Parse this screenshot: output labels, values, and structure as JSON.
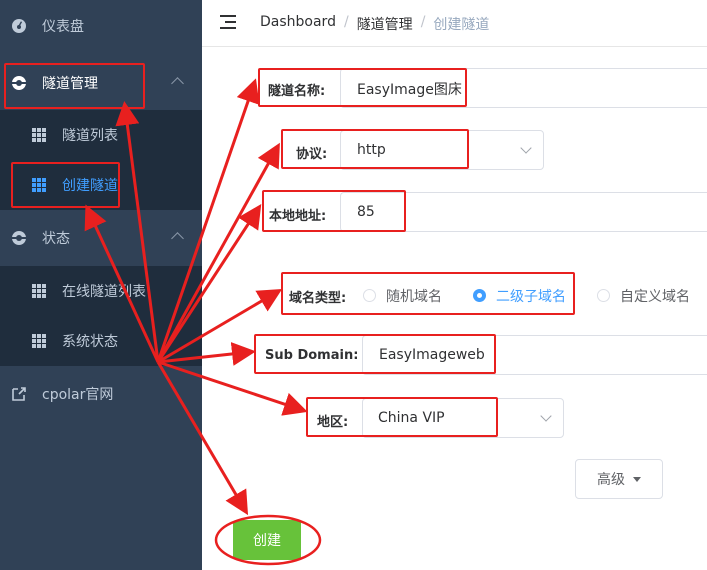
{
  "sidebar": {
    "items": [
      {
        "label": "仪表盘",
        "icon": "dashboard-icon"
      },
      {
        "label": "隧道管理",
        "icon": "tunnel-icon"
      },
      {
        "label": "状态",
        "icon": "status-icon"
      },
      {
        "label": "cpolar官网",
        "icon": "external-link-icon"
      }
    ],
    "tunnel_sub": [
      {
        "label": "隧道列表",
        "icon": "grid-icon"
      },
      {
        "label": "创建隧道",
        "icon": "grid-icon"
      }
    ],
    "status_sub": [
      {
        "label": "在线隧道列表",
        "icon": "grid-icon"
      },
      {
        "label": "系统状态",
        "icon": "grid-icon"
      }
    ]
  },
  "header": {
    "breadcrumb": [
      "Dashboard",
      "隧道管理",
      "创建隧道"
    ],
    "separator": "/"
  },
  "form": {
    "name_label": "隧道名称:",
    "name_value": "EasyImage图床",
    "protocol_label": "协议:",
    "protocol_value": "http",
    "local_label": "本地地址:",
    "local_value": "85",
    "domain_type_label": "域名类型:",
    "domain_types": [
      {
        "label": "随机域名",
        "selected": false
      },
      {
        "label": "二级子域名",
        "selected": true
      },
      {
        "label": "自定义域名",
        "selected": false
      }
    ],
    "subdomain_label": "Sub Domain:",
    "subdomain_value": "EasyImageweb",
    "region_label": "地区:",
    "region_value": "China VIP",
    "advanced_label": "高级",
    "create_label": "创建"
  },
  "colors": {
    "sidebar_bg": "#304156",
    "submenu_bg": "#1f2d3d",
    "accent": "#409eff",
    "create_button": "#67c23a",
    "annotation": "#e8201f"
  }
}
